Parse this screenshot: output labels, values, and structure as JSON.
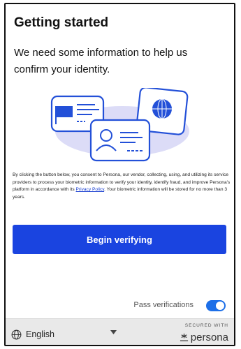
{
  "header": {
    "title": "Getting started"
  },
  "intro": {
    "text": "We need some information to help us confirm your identity."
  },
  "illustration": {
    "icons": [
      "id-card-icon",
      "passport-icon",
      "id-card-photo-icon"
    ]
  },
  "consent": {
    "text_before": "By clicking the button below, you consent to Persona, our vendor, collecting, using, and utilizing its service providers to process your biometric information to verify your identity, identify fraud, and improve Persona's platform in accordance with its ",
    "link_label": "Privacy Policy",
    "text_after": ". Your biometric information will be stored for no more than 3 years."
  },
  "actions": {
    "begin_label": "Begin verifying"
  },
  "pass_verifications": {
    "label": "Pass verifications",
    "enabled": true
  },
  "footer": {
    "language": "English",
    "secured_label": "SECURED WITH",
    "brand": "persona"
  },
  "colors": {
    "primary": "#1a44e0",
    "toggle": "#1d6fe8",
    "illustration": "#2350d8"
  }
}
